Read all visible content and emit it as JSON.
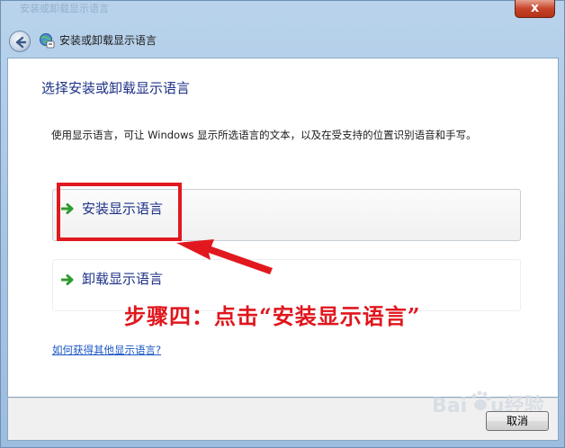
{
  "window": {
    "title": "安装或卸载显示语言",
    "close_label": "x",
    "faded_title": "安装或卸载显示语言"
  },
  "main": {
    "heading": "选择安装或卸载显示语言",
    "description": "使用显示语言，可让 Windows 显示所选语言的文本，以及在受支持的位置识别语音和手写。",
    "options": [
      {
        "label": "安装显示语言",
        "icon": "green-arrow-icon"
      },
      {
        "label": "卸载显示语言",
        "icon": "green-arrow-icon"
      }
    ],
    "help_link": "如何获得其他显示语言?"
  },
  "annotation": {
    "text": "步骤四：点击“安装显示语言”",
    "color": "#e0161d"
  },
  "footer": {
    "cancel_label": "取消"
  },
  "watermark": {
    "text": "Baidu经验"
  },
  "colors": {
    "accent_text": "#1e3287",
    "link": "#1a56c4",
    "highlight": "#e1191f"
  }
}
